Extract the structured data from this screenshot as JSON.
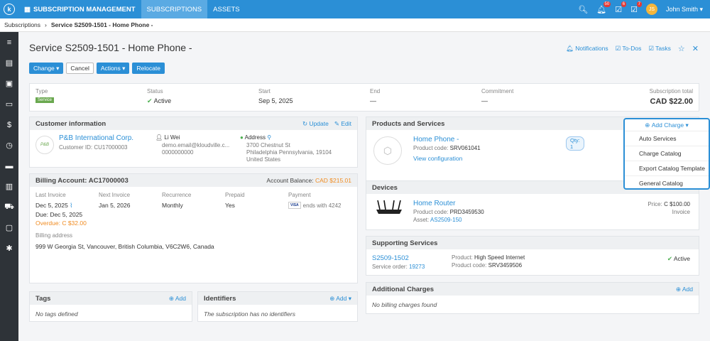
{
  "topbar": {
    "logo": "k",
    "app_menu": "SUBSCRIPTION MANAGEMENT",
    "tabs": [
      "SUBSCRIPTIONS",
      "ASSETS"
    ],
    "badges": {
      "notifications": "50",
      "todos": "6",
      "tasks": "7"
    },
    "avatar_initials": "JS",
    "user_name": "John Smith"
  },
  "breadcrumb": {
    "root": "Subscriptions",
    "current": "Service S2509-1501 - Home Phone -"
  },
  "page": {
    "title": "Service S2509-1501 - Home Phone -",
    "links": {
      "notifications": "Notifications",
      "todos": "To-Dos",
      "tasks": "Tasks"
    }
  },
  "buttons": {
    "change": "Change",
    "cancel": "Cancel",
    "actions": "Actions",
    "relocate": "Relocate"
  },
  "summary": {
    "type_label": "Type",
    "type_value": "Service",
    "status_label": "Status",
    "status_value": "Active",
    "start_label": "Start",
    "start_value": "Sep 5, 2025",
    "end_label": "End",
    "end_value": "—",
    "commitment_label": "Commitment",
    "commitment_value": "—",
    "total_label": "Subscription total",
    "total_value": "CAD $22.00"
  },
  "customer": {
    "header": "Customer information",
    "update": "Update",
    "edit": "Edit",
    "logo_text": "P&B",
    "name": "P&B International Corp.",
    "id": "Customer ID: CU17000003",
    "contact_name": "Li Wei",
    "contact_email": "demo.email@kloudville.c...",
    "contact_phone": "0000000000",
    "address_label": "Address",
    "address_lines": [
      "3700 Chestnut St",
      "Philadelphia Pennsylvania, 19104",
      "United States"
    ]
  },
  "billing": {
    "header": "Billing Account: AC17000003",
    "balance_label": "Account Balance:",
    "balance_value": "CAD $215.01",
    "last_invoice_label": "Last Invoice",
    "last_invoice": "Dec 5, 2025",
    "due": "Due: Dec 5, 2025",
    "overdue": "Overdue: C $32.00",
    "next_invoice_label": "Next Invoice",
    "next_invoice": "Jan 5, 2026",
    "recurrence_label": "Recurrence",
    "recurrence": "Monthly",
    "prepaid_label": "Prepaid",
    "prepaid": "Yes",
    "payment_label": "Payment",
    "card_brand": "VISA",
    "payment": "ends with 4242",
    "address_label": "Billing address",
    "address": "999 W Georgia St, Vancouver, British Columbia, V6C2W6, Canada"
  },
  "tags": {
    "header": "Tags",
    "add": "Add",
    "empty": "No tags defined"
  },
  "identifiers": {
    "header": "Identifiers",
    "add": "Add",
    "empty": "The subscription has no identifiers"
  },
  "products": {
    "header": "Products and Services",
    "name": "Home Phone -",
    "code_label": "Product code:",
    "code": "SRV061041",
    "qty": "Qty: 1",
    "view": "View configuration"
  },
  "add_charge": {
    "label": "Add Charge",
    "items": [
      "Auto Services",
      "Charge Catalog",
      "Export Catalog Template",
      "General Catalog"
    ]
  },
  "devices": {
    "header": "Devices",
    "name": "Home Router",
    "code_label": "Product code:",
    "code": "PRD3459530",
    "asset_label": "Asset:",
    "asset": "AS2509-150",
    "price_label": "Price:",
    "price": "C $100.00",
    "billing": "Invoice"
  },
  "supporting": {
    "header": "Supporting Services",
    "id": "S2509-1502",
    "order_label": "Service order:",
    "order": "19273",
    "product_label": "Product:",
    "product": "High Speed Internet",
    "code_label": "Product code:",
    "code": "SRV3459506",
    "status": "Active"
  },
  "additional": {
    "header": "Additional Charges",
    "add": "Add",
    "empty": "No billing charges found"
  },
  "colors": {
    "accent": "#2b8fd6",
    "sidebar": "#2e3338",
    "success": "#4caf50",
    "warning": "#f08c22",
    "danger": "#e53935"
  }
}
